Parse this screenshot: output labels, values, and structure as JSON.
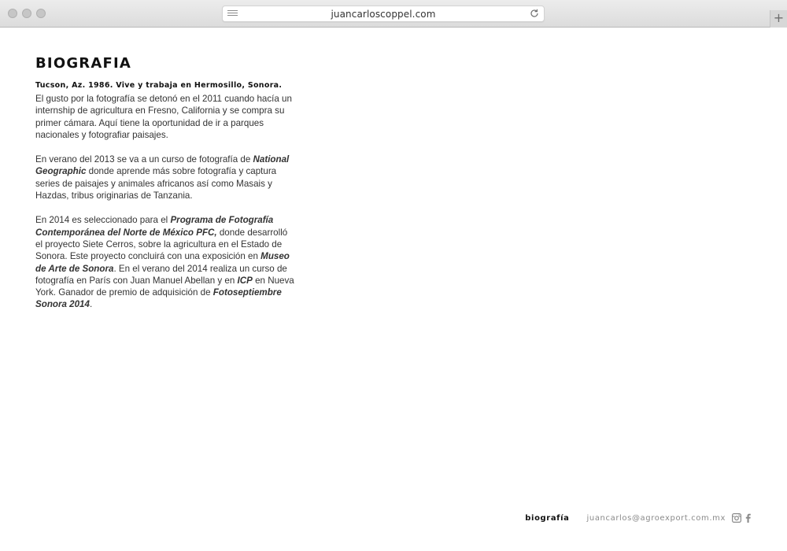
{
  "browser": {
    "url": "juancarloscoppel.com",
    "new_tab_label": "+"
  },
  "page": {
    "title": "BIOGRAFIA",
    "subtitle": "Tucson, Az. 1986. Vive y trabaja en Hermosillo, Sonora.",
    "p1": "El gusto por la fotografía se detonó en el 2011 cuando hacía un internship de agricultura en Fresno, California y se compra su primer cámara. Aquí tiene la oportunidad de ir a parques nacionales y fotografiar paisajes.",
    "p2": {
      "a": "En verano del 2013 se va a un curso de fotografía de ",
      "b": "National Geographic",
      "c": " donde aprende más sobre fotografía y captura series de paisajes y animales africanos así como Masais y Hazdas, tribus originarias de Tanzania."
    },
    "p3": {
      "a": "En 2014 es seleccionado para el ",
      "b": "Programa de Fotografía Contemporánea del Norte de México PFC,",
      "c": " donde desarrolló el proyecto Siete Cerros, sobre la agricultura en el Estado de Sonora. Este proyecto concluirá con una exposición en ",
      "d": "Museo de Arte de Sonora",
      "e": ". En el verano del 2014 realiza un curso de fotografía en París con Juan Manuel Abellan y en ",
      "f": "ICP",
      "g": " en Nueva York. Ganador de premio de adquisición de ",
      "h": "Fotoseptiembre Sonora 2014",
      "i": "."
    }
  },
  "footer": {
    "nav_label": "biografía",
    "email": "juancarlos@agroexport.com.mx",
    "icons": [
      "instagram-icon",
      "facebook-icon"
    ]
  },
  "colors": {
    "text": "#333333",
    "heading": "#111111",
    "muted": "#8a8a8a",
    "chrome": "#dcdcdc"
  }
}
